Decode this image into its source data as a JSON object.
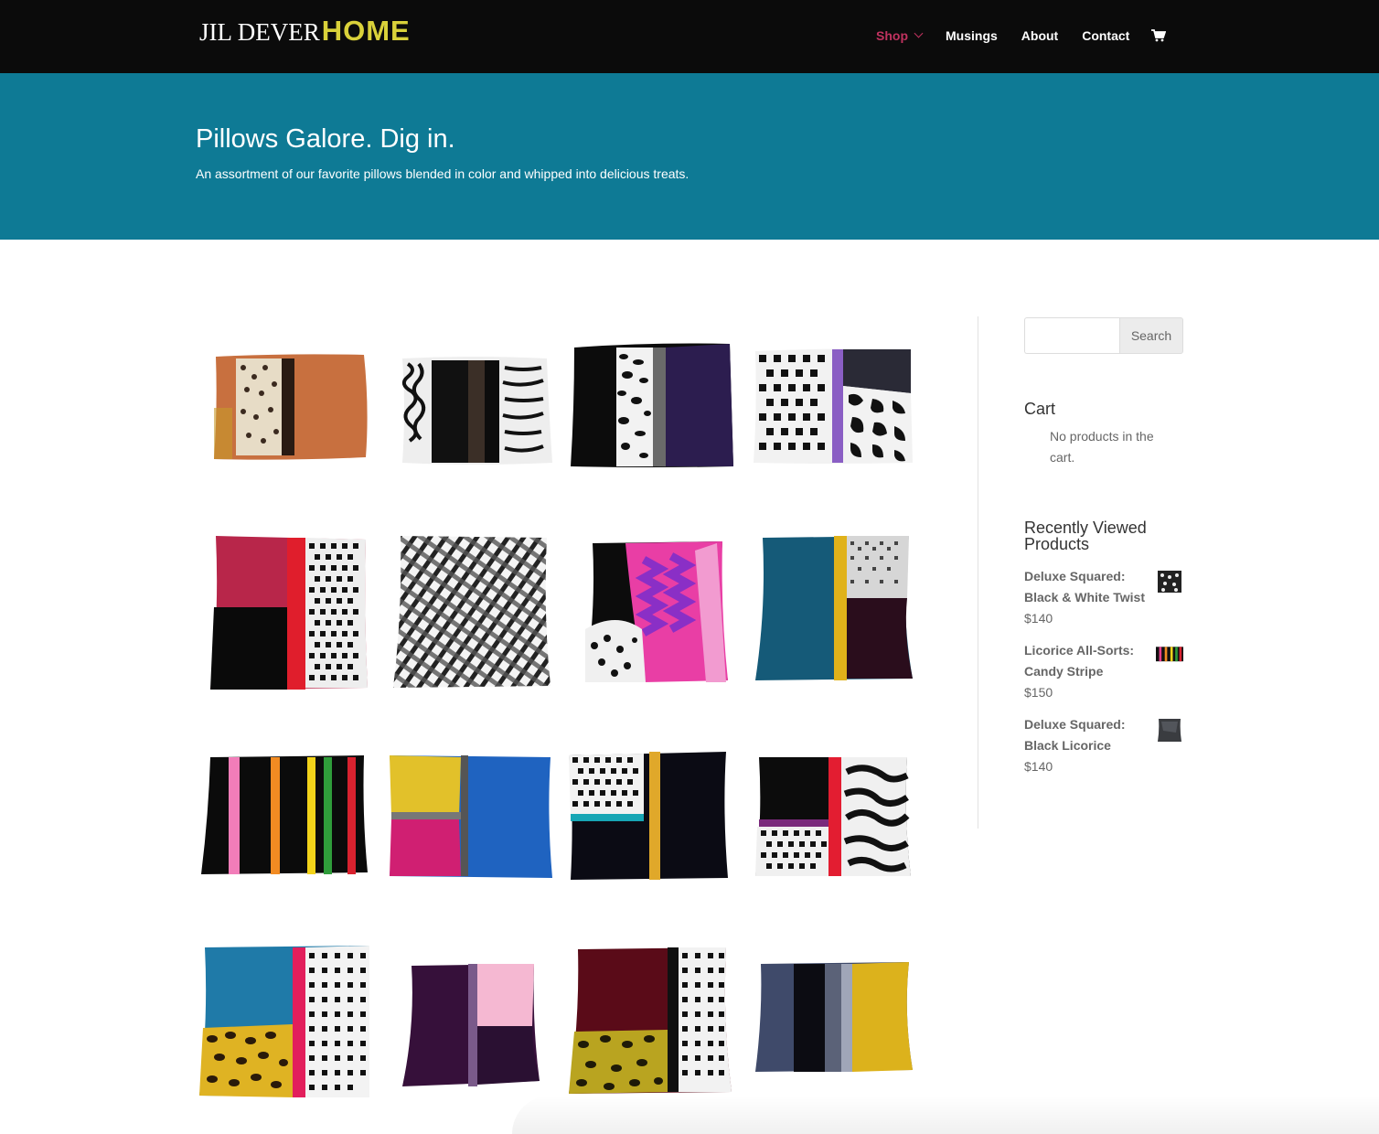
{
  "header": {
    "logo_text_1": "JIL DEVER",
    "logo_text_2": "HOME",
    "nav": [
      {
        "label": "Shop",
        "active": true
      },
      {
        "label": "Musings",
        "active": false
      },
      {
        "label": "About",
        "active": false
      },
      {
        "label": "Contact",
        "active": false
      }
    ],
    "cart_icon": "shopping-cart-icon"
  },
  "hero": {
    "title": "Pillows Galore. Dig in.",
    "subtitle": "An assortment of our favorite pillows blended in color and whipped into delicious treats."
  },
  "sidebar": {
    "search_button": "Search",
    "cart_title": "Cart",
    "cart_empty": "No products in the cart.",
    "recent_title": "Recently Viewed Products",
    "recent": [
      {
        "name": "Deluxe Squared: Black & White Twist",
        "price": "$140",
        "thumb_color": "#444"
      },
      {
        "name": "Licorice All-Sorts: Candy Stripe",
        "price": "$150",
        "thumb_color": "#111"
      },
      {
        "name": "Deluxe Squared: Black Licorice",
        "price": "$140",
        "thumb_color": "#3a3c40"
      }
    ]
  },
  "colors": {
    "topbar": "#0b0b0b",
    "hero": "#0e7a95",
    "accent": "#c0325f",
    "logo_yellow": "#d9d13a"
  }
}
